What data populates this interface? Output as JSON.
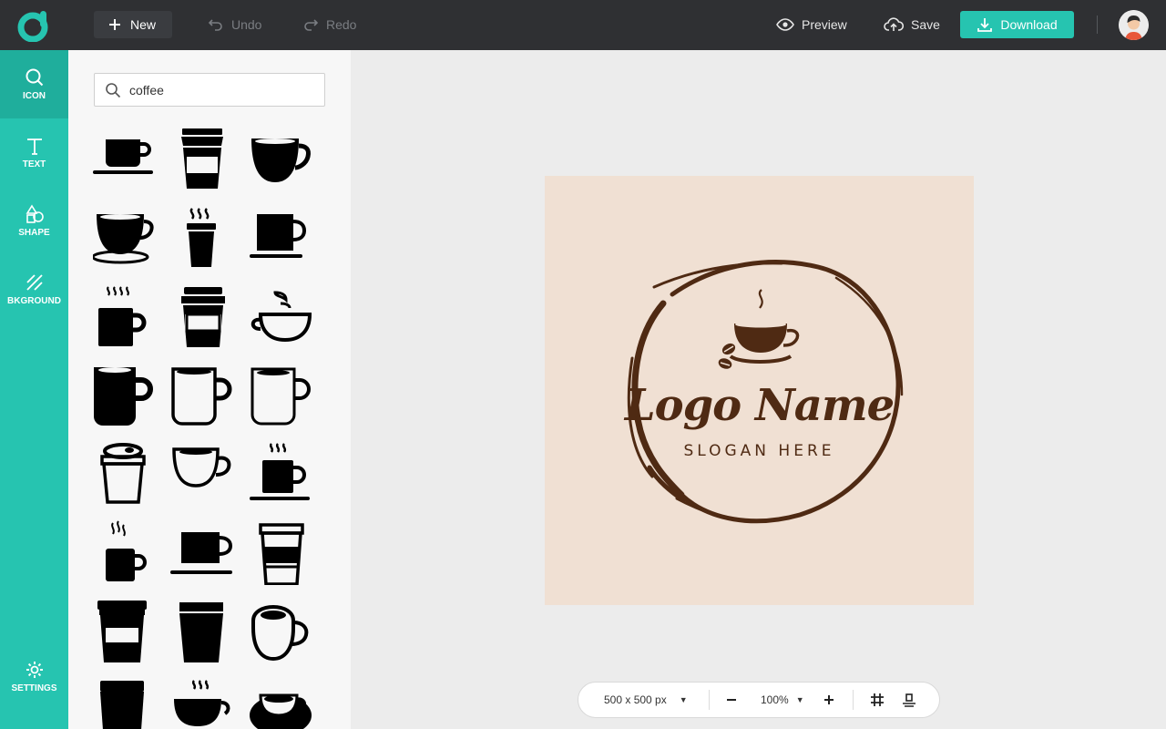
{
  "toolbar": {
    "new_label": "New",
    "undo_label": "Undo",
    "redo_label": "Redo",
    "preview_label": "Preview",
    "save_label": "Save",
    "download_label": "Download",
    "accent_color": "#26c4b0"
  },
  "sidebar": {
    "items": [
      {
        "label": "ICON",
        "icon": "search-icon",
        "active": true
      },
      {
        "label": "TEXT",
        "icon": "text-icon"
      },
      {
        "label": "SHAPE",
        "icon": "shapes-icon"
      },
      {
        "label": "BKGROUND",
        "icon": "background-icon"
      }
    ],
    "settings_label": "SETTINGS"
  },
  "icon_panel": {
    "search_value": "coffee",
    "icons": [
      "cup-saucer-icon",
      "takeaway-cup-icon",
      "round-cup-icon",
      "teacup-saucer-icon",
      "steaming-cup-icon",
      "square-cup-icon",
      "steaming-mug-icon",
      "lidded-cup-icon",
      "cup-steam-icon",
      "solid-mug-icon",
      "outline-mug-icon",
      "outline-mug-2-icon",
      "lid-cup-icon",
      "outline-cup-icon",
      "steaming-mug-2-icon",
      "small-steaming-mug-icon",
      "square-mug-icon",
      "lid-cup-2-icon",
      "paper-cup-icon",
      "tumbler-icon",
      "outline-round-cup-icon",
      "takeaway-cup-2-icon",
      "steaming-bowl-cup-icon",
      "cup-saucer-2-icon"
    ]
  },
  "canvas": {
    "logo_name": "Logo Name",
    "slogan": "SLOGAN HERE",
    "background_color": "#f0e0d3",
    "ink_color": "#4f2a13"
  },
  "bottom_bar": {
    "size_label": "500 x 500 px",
    "zoom_label": "100%"
  }
}
